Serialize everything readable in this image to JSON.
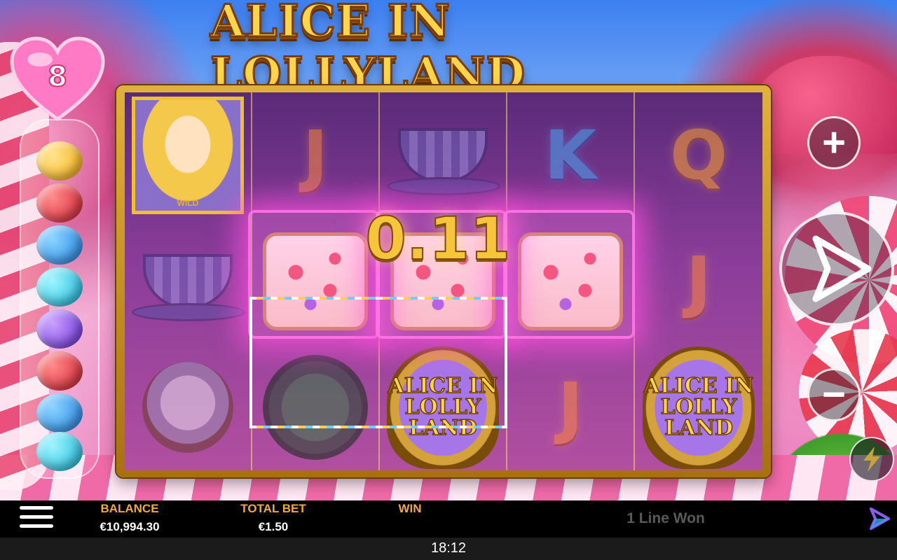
{
  "game": {
    "title": "ALICE IN LOLLYLAND",
    "win_amount": "0.11",
    "heart_counter": "8"
  },
  "reels": [
    [
      {
        "symbol": "wild-alice",
        "text": "WILD"
      },
      {
        "symbol": "teacup"
      },
      {
        "symbol": "white-rabbit"
      }
    ],
    [
      {
        "symbol": "letter",
        "text": "J"
      },
      {
        "symbol": "cake"
      },
      {
        "symbol": "mad-hatter-hat"
      }
    ],
    [
      {
        "symbol": "teacup"
      },
      {
        "symbol": "cake"
      },
      {
        "symbol": "scatter",
        "text": "ALICE IN LOLLY LAND"
      }
    ],
    [
      {
        "symbol": "letter",
        "text": "K"
      },
      {
        "symbol": "cake"
      },
      {
        "symbol": "letter",
        "text": "J"
      }
    ],
    [
      {
        "symbol": "letter",
        "text": "Q"
      },
      {
        "symbol": "letter",
        "text": "J"
      },
      {
        "symbol": "scatter",
        "text": "ALICE IN LOLLY LAND"
      }
    ]
  ],
  "bottom_bar": {
    "balance_label": "BALANCE",
    "balance_value": "€10,994.30",
    "total_bet_label": "TOTAL BET",
    "total_bet_value": "€1.50",
    "win_label": "WIN",
    "win_value": "",
    "status_message": "1 Line Won"
  },
  "clock": "18:12",
  "colors": {
    "accent_gold": "#f7c53a",
    "label_orange": "#f3a93a",
    "win_glow": "#ff50dc"
  },
  "icons": [
    "menu-icon",
    "plus-icon",
    "minus-icon",
    "spin-icon",
    "lightning-icon",
    "brand-logo-icon",
    "heart-icon"
  ]
}
